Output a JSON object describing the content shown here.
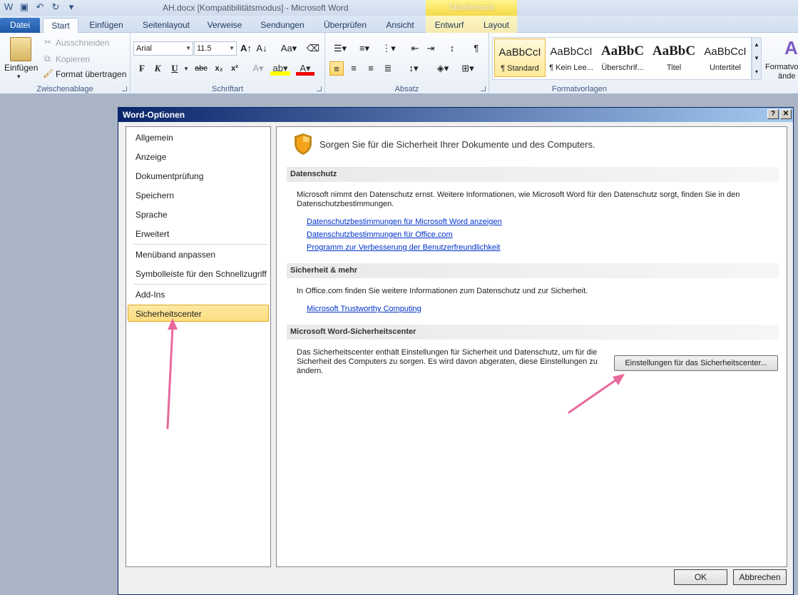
{
  "window": {
    "title": "AH.docx [Kompatibilitätsmodus]  -  Microsoft Word",
    "context_tab_header": "Tabellentools"
  },
  "tabs": [
    "Datei",
    "Start",
    "Einfügen",
    "Seitenlayout",
    "Verweise",
    "Sendungen",
    "Überprüfen",
    "Ansicht",
    "Entwurf",
    "Layout"
  ],
  "ribbon": {
    "clipboard": {
      "label": "Zwischenablage",
      "paste": "Einfügen",
      "cut": "Ausschneiden",
      "copy": "Kopieren",
      "format_painter": "Format übertragen"
    },
    "font": {
      "label": "Schriftart",
      "font_name": "Arial",
      "font_size": "11.5",
      "bold": "F",
      "italic": "K",
      "underline": "U",
      "strike": "abc",
      "subscript": "x₂",
      "superscript": "x²"
    },
    "paragraph": {
      "label": "Absatz"
    },
    "styles": {
      "label": "Formatvorlagen",
      "items": [
        {
          "preview": "AaBbCcI",
          "name": "¶ Standard"
        },
        {
          "preview": "AaBbCcI",
          "name": "¶ Kein Lee..."
        },
        {
          "preview": "AaBbC",
          "name": "Überschrif..."
        },
        {
          "preview": "AaBbC",
          "name": "Titel"
        },
        {
          "preview": "AaBbCcI",
          "name": "Untertitel"
        }
      ],
      "change_styles_line1": "Formatvo",
      "change_styles_line2": "ände"
    }
  },
  "dialog": {
    "title": "Word-Optionen",
    "help_button": "?",
    "close_button": "✕",
    "nav": [
      "Allgemein",
      "Anzeige",
      "Dokumentprüfung",
      "Speichern",
      "Sprache",
      "Erweitert",
      "Menüband anpassen",
      "Symbolleiste für den Schnellzugriff",
      "Add-Ins",
      "Sicherheitscenter"
    ],
    "selected_nav": "Sicherheitscenter",
    "header": "Sorgen Sie für die Sicherheit Ihrer Dokumente und des Computers.",
    "sections": [
      {
        "title": "Datenschutz",
        "text": "Microsoft nimmt den Datenschutz ernst. Weitere Informationen, wie Microsoft Word für den Datenschutz sorgt, finden Sie in den Datenschutzbestimmungen.",
        "links": [
          "Datenschutzbestimmungen für Microsoft Word anzeigen",
          "Datenschutzbestimmungen für Office.com",
          "Programm zur Verbesserung der Benutzerfreundlichkeit"
        ]
      },
      {
        "title": "Sicherheit & mehr",
        "text": "In Office.com finden Sie weitere Informationen zum Datenschutz und zur Sicherheit.",
        "links": [
          "Microsoft Trustworthy Computing"
        ]
      },
      {
        "title": "Microsoft Word-Sicherheitscenter",
        "text": "Das Sicherheitscenter enthält Einstellungen für Sicherheit und Datenschutz, um für die Sicherheit des Computers zu sorgen. Es wird davon abgeraten, diese Einstellungen zu ändern.",
        "button": "Einstellungen für das Sicherheitscenter..."
      }
    ],
    "ok": "OK",
    "cancel": "Abbrechen"
  },
  "colors": {
    "highlight_arrow": "#e8699c",
    "selected_item": "#fcdd80",
    "link": "#0033cc",
    "file_tab": "#1e5aa8"
  }
}
